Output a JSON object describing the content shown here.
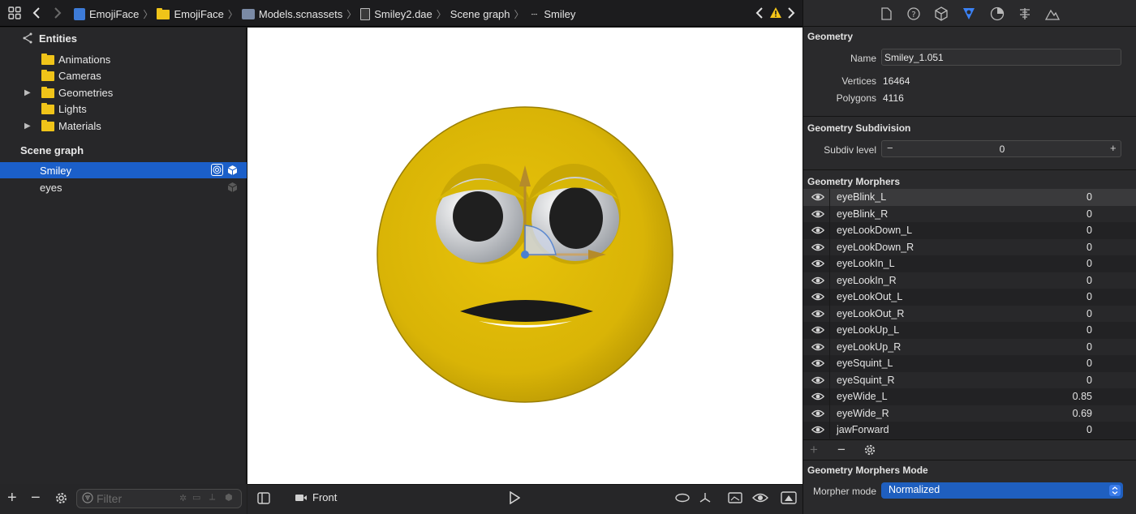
{
  "breadcrumb": {
    "items": [
      "EmojiFace",
      "EmojiFace",
      "Models.scnassets",
      "Smiley2.dae",
      "Scene graph",
      "Smiley"
    ]
  },
  "left": {
    "entities_title": "Entities",
    "entities": [
      {
        "label": "Animations",
        "expandable": false
      },
      {
        "label": "Cameras",
        "expandable": false
      },
      {
        "label": "Geometries",
        "expandable": true
      },
      {
        "label": "Lights",
        "expandable": false
      },
      {
        "label": "Materials",
        "expandable": true
      }
    ],
    "scene_graph_title": "Scene graph",
    "scene_nodes": [
      {
        "label": "Smiley",
        "selected": true
      },
      {
        "label": "eyes",
        "selected": false
      }
    ],
    "filter_placeholder": "Filter"
  },
  "viewport": {
    "camera_label": "Front"
  },
  "inspector": {
    "geometry_title": "Geometry",
    "name_label": "Name",
    "name_value": "Smiley_1.051",
    "vertices_label": "Vertices",
    "vertices_value": "16464",
    "polygons_label": "Polygons",
    "polygons_value": "4116",
    "subdivision_title": "Geometry Subdivision",
    "subdiv_label": "Subdiv level",
    "subdiv_value": "0",
    "morphers_title": "Geometry Morphers",
    "morphers": [
      {
        "name": "eyeBlink_L",
        "value": "0"
      },
      {
        "name": "eyeBlink_R",
        "value": "0"
      },
      {
        "name": "eyeLookDown_L",
        "value": "0"
      },
      {
        "name": "eyeLookDown_R",
        "value": "0"
      },
      {
        "name": "eyeLookIn_L",
        "value": "0"
      },
      {
        "name": "eyeLookIn_R",
        "value": "0"
      },
      {
        "name": "eyeLookOut_L",
        "value": "0"
      },
      {
        "name": "eyeLookOut_R",
        "value": "0"
      },
      {
        "name": "eyeLookUp_L",
        "value": "0"
      },
      {
        "name": "eyeLookUp_R",
        "value": "0"
      },
      {
        "name": "eyeSquint_L",
        "value": "0"
      },
      {
        "name": "eyeSquint_R",
        "value": "0"
      },
      {
        "name": "eyeWide_L",
        "value": "0.85"
      },
      {
        "name": "eyeWide_R",
        "value": "0.69"
      },
      {
        "name": "jawForward",
        "value": "0"
      }
    ],
    "morphers_mode_title": "Geometry Morphers Mode",
    "morpher_mode_label": "Morpher mode",
    "morpher_mode_value": "Normalized"
  },
  "colors": {
    "accent": "#1b5fc9",
    "smiley_yellow": "#e8c30a",
    "warning": "#f5c518"
  }
}
